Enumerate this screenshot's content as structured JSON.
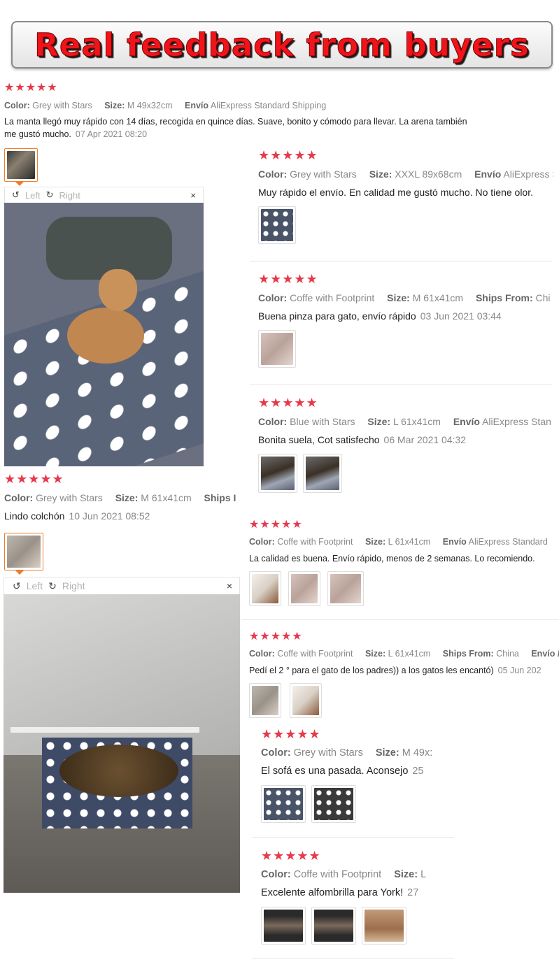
{
  "banner": {
    "title": "Real feedback from buyers"
  },
  "labels": {
    "color": "Color:",
    "size": "Size:",
    "envio": "Envío",
    "ships_from": "Ships From:",
    "rating": "★★★★★"
  },
  "viewer": {
    "left": "Left",
    "right": "Right",
    "rotate_left_icon": "↺",
    "rotate_right_icon": "↻",
    "close_icon": "×"
  },
  "reviews": [
    {
      "color": "Grey with Stars",
      "size": "M 49x32cm",
      "ship_label": "Envío",
      "ship": "AliExpress Standard Shipping",
      "text1": "La manta llegó muy rápido con 14 días, recogida en quince días. Suave, bonito y cómodo para llevar. La arena también",
      "text2": "me gustó mucho.",
      "date": "07 Apr 2021 08:20"
    },
    {
      "color": "Grey with Stars",
      "size": "XXXL 89x68cm",
      "ship_label": "Envío",
      "ship": "AliExpress S",
      "text": "Muy rápido el envío. En calidad me gustó mucho. No tiene olor.",
      "date": ""
    },
    {
      "color": "Coffe with Footprint",
      "size": "M 61x41cm",
      "ship_label": "Ships From:",
      "ship": "Chi",
      "text": "Buena pinza para gato, envío rápido",
      "date": "03 Jun 2021 03:44"
    },
    {
      "color": "Blue with Stars",
      "size": "L 61x41cm",
      "ship_label": "Envío",
      "ship": "AliExpress Stan",
      "text": "Bonita suela, Cot satisfecho",
      "date": "06 Mar 2021 04:32"
    },
    {
      "color": "Grey with Stars",
      "size": "M 61x41cm",
      "ship_label": "Ships I",
      "ship": "",
      "text": "Lindo colchón",
      "date": "10 Jun 2021 08:52"
    },
    {
      "color": "Coffe with Footprint",
      "size": "L 61x41cm",
      "ship_label": "Envío",
      "ship": "AliExpress Standard",
      "text": "La calidad es buena. Envío rápido, menos de 2 semanas. Lo recomiendo.",
      "date": ""
    },
    {
      "color": "Coffe with Footprint",
      "size": "L 61x41cm",
      "ship_label": "Ships From:",
      "ship": "China",
      "ship2": "Envío /",
      "text": "Pedí el 2 ° para el gato de los padres)) a los gatos les encantó)",
      "date": "05 Jun 202"
    },
    {
      "color": "Grey with Stars",
      "size": "M 49x:",
      "text": "El sofá es una pasada. Aconsejo",
      "date": "25"
    },
    {
      "color": "Coffe with Footprint",
      "size": "L",
      "text": "Excelente alfombrilla para York!",
      "date": "27"
    }
  ]
}
